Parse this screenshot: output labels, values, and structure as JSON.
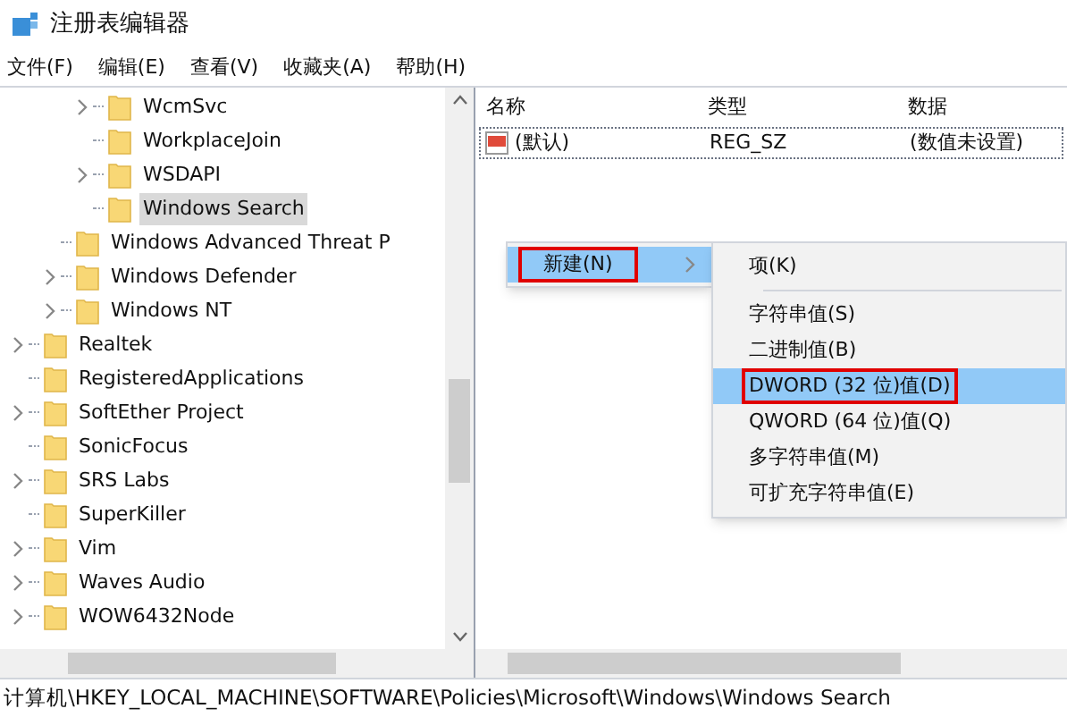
{
  "window": {
    "title": "注册表编辑器"
  },
  "menu_bar": [
    "文件(F)",
    "编辑(E)",
    "查看(V)",
    "收藏夹(A)",
    "帮助(H)"
  ],
  "tree": [
    {
      "children": [
        {
          "children": [
            {
              "children": [
                {
                  "label": "WcmSvc",
                  "expandable": true,
                  "selected": false
                },
                {
                  "label": "WorkplaceJoin",
                  "expandable": false,
                  "selected": false
                },
                {
                  "label": "WSDAPI",
                  "expandable": true,
                  "selected": false
                },
                {
                  "label": "Windows Search",
                  "expandable": false,
                  "selected": true
                }
              ]
            },
            {
              "label": "Windows Advanced Threat P",
              "expandable": false,
              "selected": false
            },
            {
              "label": "Windows Defender",
              "expandable": true,
              "selected": false
            },
            {
              "label": "Windows NT",
              "expandable": true,
              "selected": false
            }
          ]
        },
        {
          "label": "Realtek",
          "expandable": true,
          "selected": false
        },
        {
          "label": "RegisteredApplications",
          "expandable": false,
          "selected": false
        },
        {
          "label": "SoftEther Project",
          "expandable": true,
          "selected": false
        },
        {
          "label": "SonicFocus",
          "expandable": false,
          "selected": false
        },
        {
          "label": "SRS Labs",
          "expandable": true,
          "selected": false
        },
        {
          "label": "SuperKiller",
          "expandable": false,
          "selected": false
        },
        {
          "label": "Vim",
          "expandable": true,
          "selected": false
        },
        {
          "label": "Waves Audio",
          "expandable": true,
          "selected": false
        },
        {
          "label": "WOW6432Node",
          "expandable": true,
          "selected": false
        }
      ]
    }
  ],
  "values": {
    "columns": [
      "名称",
      "类型",
      "数据"
    ],
    "rows": [
      {
        "name": "(默认)",
        "type": "REG_SZ",
        "data": "(数值未设置)"
      }
    ]
  },
  "context_menu": {
    "items": [
      {
        "label": "新建(N)",
        "selected": true,
        "highlighted": true
      }
    ]
  },
  "submenu": {
    "items": [
      {
        "kind": "item",
        "label": "项(K)",
        "selected": false,
        "highlighted": false
      },
      {
        "kind": "separator"
      },
      {
        "kind": "item",
        "label": "字符串值(S)",
        "selected": false,
        "highlighted": false
      },
      {
        "kind": "item",
        "label": "二进制值(B)",
        "selected": false,
        "highlighted": false
      },
      {
        "kind": "item",
        "label": "DWORD (32 位)值(D)",
        "selected": true,
        "highlighted": true
      },
      {
        "kind": "item",
        "label": "QWORD (64 位)值(Q)",
        "selected": false,
        "highlighted": false
      },
      {
        "kind": "item",
        "label": "多字符串值(M)",
        "selected": false,
        "highlighted": false
      },
      {
        "kind": "item",
        "label": "可扩充字符串值(E)",
        "selected": false,
        "highlighted": false
      }
    ]
  },
  "status_bar": "计算机\\HKEY_LOCAL_MACHINE\\SOFTWARE\\Policies\\Microsoft\\Windows\\Windows Search"
}
